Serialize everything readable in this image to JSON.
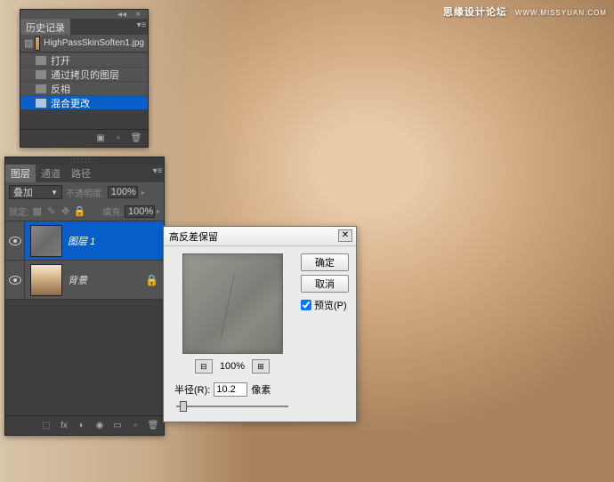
{
  "watermark": {
    "main": "思缘设计论坛",
    "sub": "WWW.MISSYUAN.COM"
  },
  "history": {
    "title": "历史记录",
    "filename": "HighPassSkinSoften1.jpg",
    "items": [
      {
        "label": "打开"
      },
      {
        "label": "通过拷贝的图层"
      },
      {
        "label": "反相"
      },
      {
        "label": "混合更改",
        "selected": true
      }
    ]
  },
  "layers": {
    "tabs": {
      "active": "图层",
      "t2": "通道",
      "t3": "路径"
    },
    "blend_mode": "叠加",
    "opacity_label": "不透明度:",
    "opacity_value": "100%",
    "lock_label": "锁定:",
    "fill_label": "填充:",
    "fill_value": "100%",
    "rows": [
      {
        "name": "图层 1",
        "selected": true,
        "thumb": "gray"
      },
      {
        "name": "背景",
        "selected": false,
        "thumb": "photo",
        "locked": true
      }
    ]
  },
  "dialog": {
    "title": "高反差保留",
    "ok": "确定",
    "cancel": "取消",
    "preview": "预览(P)",
    "zoom": "100%",
    "radius_label": "半径(R):",
    "radius_value": "10.2",
    "radius_unit": "像素"
  }
}
